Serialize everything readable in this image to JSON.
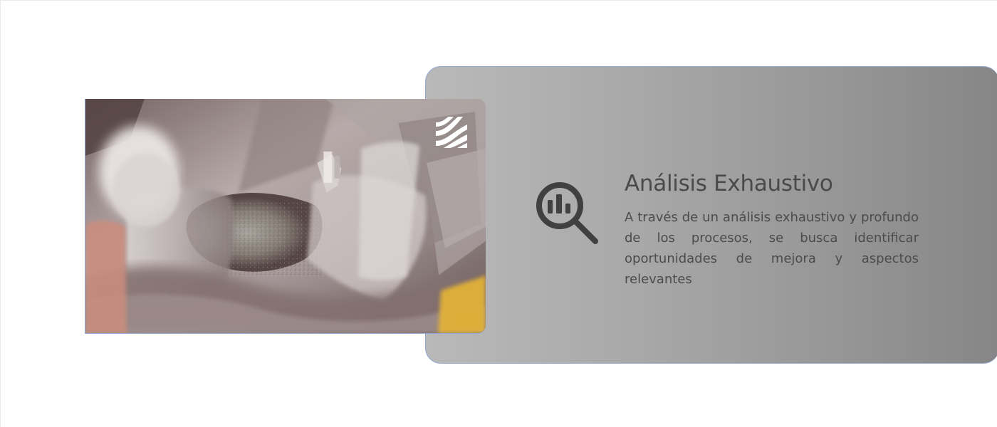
{
  "section": {
    "title": "Análisis Exhaustivo",
    "description": "A través de un análisis exhaustivo y profundo de los procesos, se busca identificar oportunidades de mejora y aspectos relevantes"
  },
  "visuals": {
    "photo_subject": "construction-chute-photo",
    "logo_icon": "striped-logo-icon",
    "analysis_icon": "magnifier-bar-chart-icon",
    "colors": {
      "panel_start": "#b9b9b9",
      "panel_end": "#868686",
      "text_primary": "#4a4a4a",
      "accent_border": "#8ea6d1",
      "photo_highlight": "#e0ad2e"
    }
  }
}
